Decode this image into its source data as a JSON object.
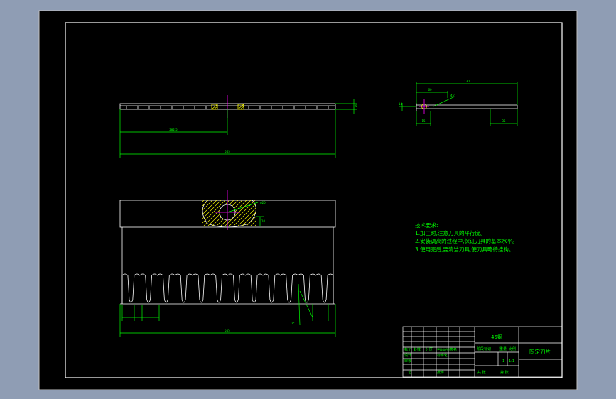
{
  "colors": {
    "background": "#8f9db4",
    "paper": "#000000",
    "frame": "#ffffff",
    "geometry": "#ffffff",
    "dimension": "#00ff00",
    "centerline": "#ff00ff",
    "notes": "#00ff00",
    "hatch": "#ffff00"
  },
  "dims": {
    "front_half": "282.5",
    "front_total": "565",
    "front_thickness": "5",
    "hole_dia": "φ20",
    "hole_offset": "10",
    "tooth_total": "565",
    "tooth_angle": "2°",
    "side_total": "130",
    "side_left": "15",
    "side_right": "35",
    "side_hole": "14",
    "side_top": "60",
    "side_angle": "45°"
  },
  "notes": {
    "title": "技术要求:",
    "items": [
      "1.加工时,注意刀具的平行度。",
      "2.安装调高的过程中,保证刀具的基本水平。",
      "3.使用完后,要清洁刀具,使刀具略待挂钩。"
    ]
  },
  "title_block": {
    "material": "45钢",
    "part_name": "固定刀片",
    "scale": "1:1",
    "count": "1",
    "r_biaoji": "标记",
    "r_chushu": "处数",
    "r_fenqu": "分区",
    "r_gengai": "更改文件号",
    "r_qianming": "签名",
    "r_sheji": "设计",
    "r_biaozhunhua": "标准化",
    "r_jieduan": "阶段标记",
    "r_zhongliang": "重量",
    "r_bili": "比例",
    "r_shenhe": "审核",
    "r_gongyi": "工艺",
    "r_pizhun": "批准",
    "r_gongzhang": "共 张",
    "r_dizhang": "第 张"
  }
}
